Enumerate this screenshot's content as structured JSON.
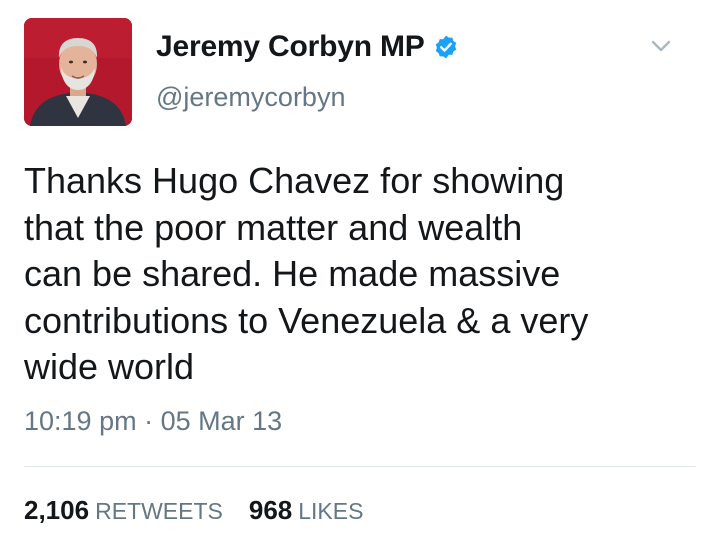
{
  "tweet": {
    "author": {
      "display_name": "Jeremy Corbyn MP",
      "handle": "@jeremycorbyn",
      "verified": true,
      "verified_icon": "verified-badge-icon",
      "avatar_icon": "profile-avatar"
    },
    "menu_icon": "chevron-down-icon",
    "text": "Thanks Hugo Chavez for showing\nthat the poor matter and wealth\ncan be shared. He made massive\ncontributions to Venezuela & a very\nwide world",
    "time": "10:19 pm",
    "separator": "·",
    "date": "05 Mar 13",
    "stats": {
      "retweets_count": "2,106",
      "retweets_label": "RETWEETS",
      "likes_count": "968",
      "likes_label": "LIKES"
    }
  },
  "colors": {
    "text_primary": "#14171a",
    "text_secondary": "#657786",
    "verified_blue": "#1da1f2",
    "divider": "#e1e8ed",
    "avatar_bg": "#b4182c"
  }
}
